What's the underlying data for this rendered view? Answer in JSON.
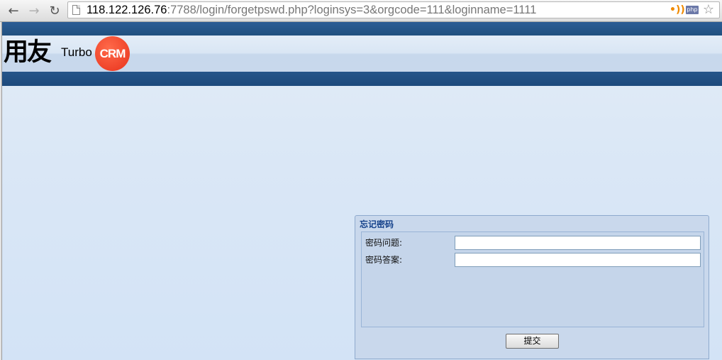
{
  "browser": {
    "back_icon": "arrow-left",
    "forward_icon": "arrow-right",
    "reload_icon": "reload",
    "url_host": "118.122.126.76",
    "url_rest": ":7788/login/forgetpswd.php?loginsys=3&orgcode=111&loginname=1111",
    "rss_icon": "rss",
    "php_badge": "php",
    "bookmark_icon": "star"
  },
  "logo": {
    "brand_cn": "用友",
    "product": "Turbo",
    "crm": "CRM",
    "crm_color": "#e8321c"
  },
  "colors": {
    "header_dark": "#21507f",
    "panel_title": "#15428b",
    "page_bg": "#dae7f6"
  },
  "panel": {
    "title": "忘记密码",
    "question_label": "密码问题:",
    "question_value": "",
    "answer_label": "密码答案:",
    "answer_value": "",
    "submit_label": "提交"
  }
}
